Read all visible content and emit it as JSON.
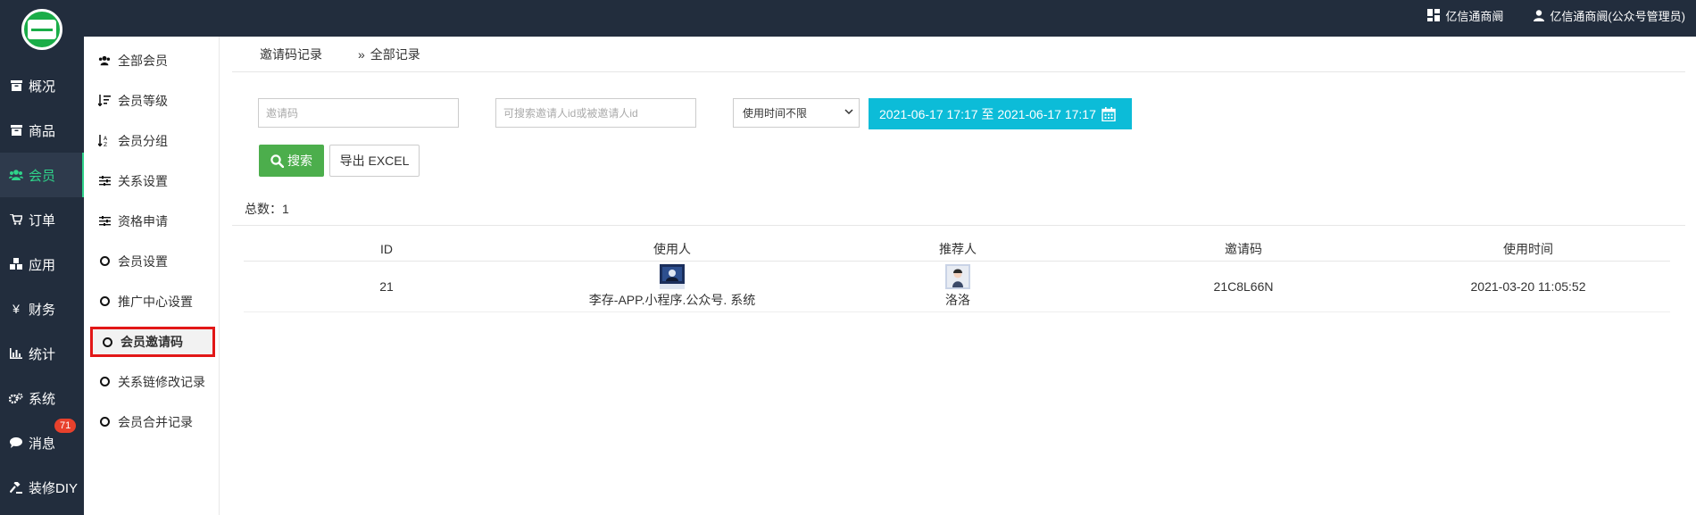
{
  "topbar": {
    "shop_link": "亿信通商阛",
    "user_link": "亿信通商阛(公众号管理员)"
  },
  "sidebar": {
    "items": [
      {
        "label": "概况",
        "icon": "archive-icon"
      },
      {
        "label": "商品",
        "icon": "archive-icon"
      },
      {
        "label": "会员",
        "icon": "users-icon",
        "active": true
      },
      {
        "label": "订单",
        "icon": "cart-icon"
      },
      {
        "label": "应用",
        "icon": "cubes-icon"
      },
      {
        "label": "财务",
        "icon": "yen-icon"
      },
      {
        "label": "统计",
        "icon": "bar-chart-icon"
      },
      {
        "label": "系统",
        "icon": "gears-icon"
      },
      {
        "label": "消息",
        "icon": "comment-icon",
        "badge": "71"
      },
      {
        "label": "装修DIY",
        "icon": "gavel-icon"
      }
    ]
  },
  "subnav": {
    "items": [
      {
        "label": "全部会员",
        "icon": "users-icon"
      },
      {
        "label": "会员等级",
        "icon": "sort-numeric-icon"
      },
      {
        "label": "会员分组",
        "icon": "sort-alpha-icon"
      },
      {
        "label": "关系设置",
        "icon": "sliders-icon"
      },
      {
        "label": "资格申请",
        "icon": "sliders-icon"
      },
      {
        "label": "会员设置",
        "icon": "circle-icon"
      },
      {
        "label": "推广中心设置",
        "icon": "circle-icon"
      },
      {
        "label": "会员邀请码",
        "icon": "circle-icon",
        "active": true
      },
      {
        "label": "关系链修改记录",
        "icon": "circle-icon"
      },
      {
        "label": "会员合并记录",
        "icon": "circle-icon"
      }
    ]
  },
  "breadcrumb": {
    "link": "邀请码记录",
    "separator": "»",
    "current": "全部记录"
  },
  "filters": {
    "code_placeholder": "邀请码",
    "id_placeholder": "可搜索邀请人id或被邀请人id",
    "time_select": "使用时间不限",
    "date_range": "2021-06-17 17:17 至 2021-06-17 17:17"
  },
  "actions": {
    "search": "搜索",
    "export": "导出 EXCEL"
  },
  "summary": {
    "total_label": "总数：",
    "total_value": "1"
  },
  "table": {
    "columns": [
      "ID",
      "使用人",
      "推荐人",
      "邀请码",
      "使用时间"
    ],
    "rows": [
      {
        "id": "21",
        "user": "李存-APP.小程序.公众号. 系统",
        "referrer": "洛洛",
        "code": "21C8L66N",
        "time": "2021-03-20 11:05:52"
      }
    ]
  },
  "colors": {
    "sidebar_bg": "#222d3d",
    "accent_green": "#2fd38a",
    "search_button": "#4cae4c",
    "date_button": "#0cbcd8",
    "highlight_border": "#e21717",
    "badge": "#e8412c"
  }
}
